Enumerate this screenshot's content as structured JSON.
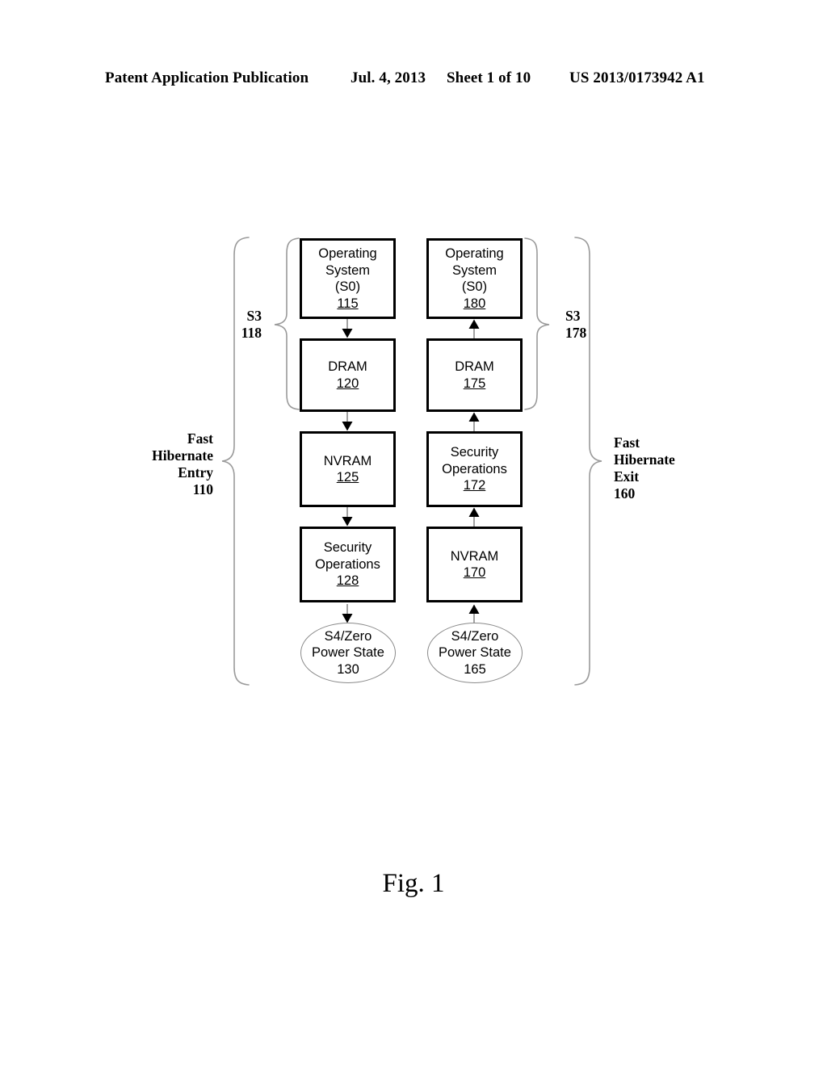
{
  "header": {
    "publication": "Patent Application Publication",
    "date": "Jul. 4, 2013",
    "sheet": "Sheet 1 of 10",
    "patent_number": "US 2013/0173942 A1"
  },
  "caption": "Fig. 1",
  "diagram": {
    "left_column": {
      "title": "Fast Hibernate Entry",
      "nodes": [
        {
          "line1": "Operating",
          "line2": "System",
          "line3": "(S0)",
          "ref": "115",
          "shape": "box"
        },
        {
          "line1": "DRAM",
          "ref": "120",
          "shape": "box"
        },
        {
          "line1": "NVRAM",
          "ref": "125",
          "shape": "box"
        },
        {
          "line1": "Security",
          "line2": "Operations",
          "ref": "128",
          "shape": "box"
        },
        {
          "line1": "S4/Zero",
          "line2": "Power State",
          "ref": "130",
          "shape": "ellipse"
        }
      ]
    },
    "right_column": {
      "title": "Fast Hibernate Exit",
      "nodes": [
        {
          "line1": "Operating",
          "line2": "System",
          "line3": "(S0)",
          "ref": "180",
          "shape": "box"
        },
        {
          "line1": "DRAM",
          "ref": "175",
          "shape": "box"
        },
        {
          "line1": "Security",
          "line2": "Operations",
          "ref": "172",
          "shape": "box"
        },
        {
          "line1": "NVRAM",
          "ref": "170",
          "shape": "box"
        },
        {
          "line1": "S4/Zero",
          "line2": "Power State",
          "ref": "165",
          "shape": "ellipse"
        }
      ]
    },
    "braces": {
      "left_inner": {
        "label": "S3",
        "ref": "118",
        "text": "S3\n118"
      },
      "left_outer": {
        "label": "Fast Hibernate Entry",
        "ref": "110",
        "text": "Fast\nHibernate\nEntry\n110"
      },
      "right_inner": {
        "label": "S3",
        "ref": "178",
        "text": "S3\n178"
      },
      "right_outer": {
        "label": "Fast Hibernate Exit",
        "ref": "160",
        "text": "Fast\nHibernate\nExit\n160"
      }
    },
    "colors": {
      "box_border": "#000000",
      "ellipse_border": "#8a8a8a",
      "arrow": "#000000",
      "connector_line": "#8a8a8a",
      "brace": "#9a9a9a",
      "background": "#ffffff"
    }
  }
}
